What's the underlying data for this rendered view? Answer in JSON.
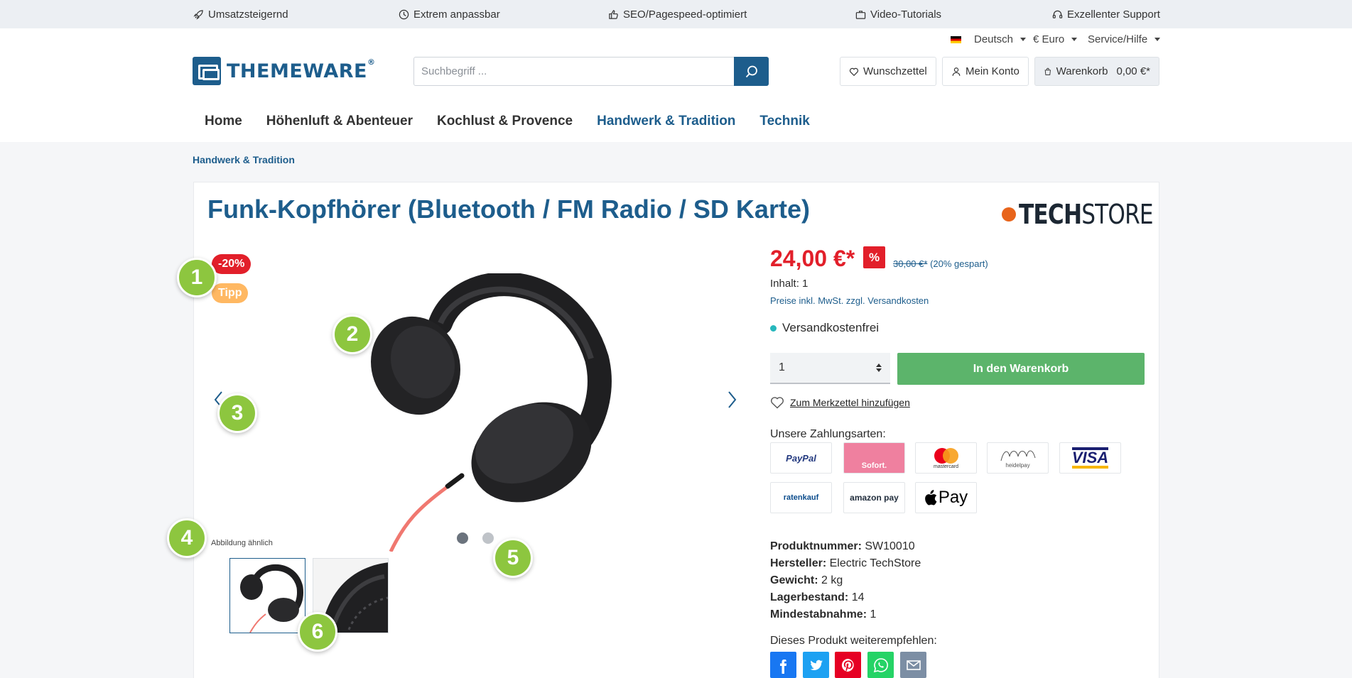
{
  "usp_bar": {
    "items": [
      {
        "label": "Umsatzsteigernd",
        "icon": "rocket-icon"
      },
      {
        "label": "Extrem anpassbar",
        "icon": "clock-icon"
      },
      {
        "label": "SEO/Pagespeed-optimiert",
        "icon": "thumbs-up-icon"
      },
      {
        "label": "Video-Tutorials",
        "icon": "briefcase-icon"
      },
      {
        "label": "Exzellenter Support",
        "icon": "headset-icon"
      }
    ]
  },
  "topnav": {
    "language": "Deutsch",
    "currency": "€ Euro",
    "service": "Service/Hilfe"
  },
  "header": {
    "logo_text": "THEMEWARE",
    "logo_reg": "®",
    "search_placeholder": "Suchbegriff ...",
    "wishlist": "Wunschzettel",
    "account": "Mein Konto",
    "cart_label": "Warenkorb",
    "cart_total": "0,00 €*"
  },
  "mainnav": {
    "items": [
      "Home",
      "Höhenluft & Abenteuer",
      "Kochlust & Provence",
      "Handwerk & Tradition",
      "Technik"
    ]
  },
  "breadcrumb": "Handwerk & Tradition",
  "product": {
    "title": "Funk-Kopfhörer (Bluetooth / FM Radio / SD Karte)",
    "manufacturer_logo_bold": "TECH",
    "manufacturer_logo_light": "STORE",
    "badge_sale": "-20%",
    "badge_tipp": "Tipp",
    "image_note": "Abbildung ähnlich",
    "price": "24,00 €*",
    "percent_badge": "%",
    "old_price": "30,00 €*",
    "saved": "(20% gespart)",
    "content": "Inhalt: 1",
    "tax_note": "Preise inkl. MwSt. zzgl. Versandkosten",
    "shipping": "Versandkostenfrei",
    "quantity": "1",
    "add_to_cart": "In den Warenkorb",
    "add_to_wishlist": "Zum Merkzettel hinzufügen",
    "payment_title": "Unsere Zahlungsarten:",
    "payments": [
      "PayPal",
      "Sofort.",
      "mastercard",
      "heidelpay",
      "VISA",
      "ratenkauf",
      "amazon pay",
      "Pay"
    ],
    "details": [
      {
        "label": "Produktnummer:",
        "value": "SW10010"
      },
      {
        "label": "Hersteller:",
        "value": "Electric TechStore"
      },
      {
        "label": "Gewicht:",
        "value": "2 kg"
      },
      {
        "label": "Lagerbestand:",
        "value": "14"
      },
      {
        "label": "Mindestabnahme:",
        "value": "1"
      }
    ],
    "recommend_title": "Dieses Produkt weiterempfehlen:"
  },
  "markers": [
    "1",
    "2",
    "3",
    "4",
    "5",
    "6"
  ],
  "colors": {
    "brand": "#1d5d8c",
    "sale": "#e21f2a",
    "cart_button": "#5cb46b",
    "marker": "#8dc63f",
    "tipp": "#ffb862"
  }
}
